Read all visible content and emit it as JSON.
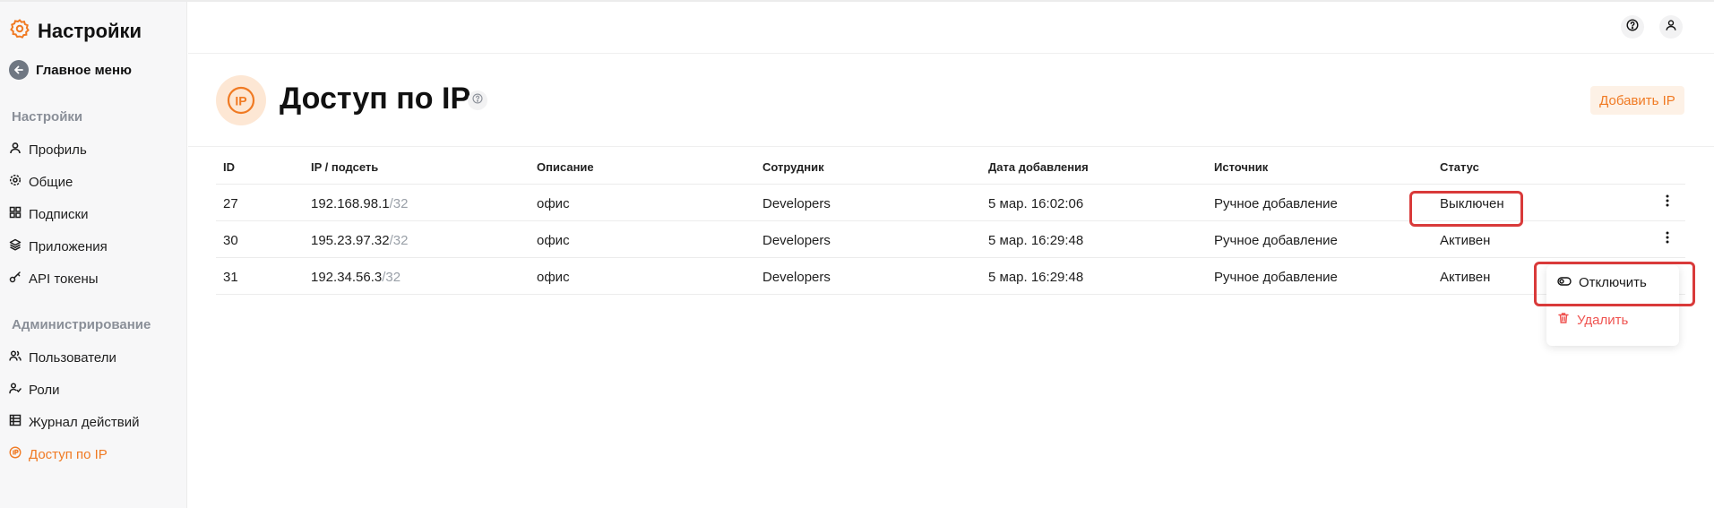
{
  "sidebar": {
    "title": "Настройки",
    "back_label": "Главное меню",
    "section_settings": "Настройки",
    "settings_items": [
      {
        "label": "Профиль",
        "icon": "user-icon"
      },
      {
        "label": "Общие",
        "icon": "gear-icon"
      },
      {
        "label": "Подписки",
        "icon": "grid-icon"
      },
      {
        "label": "Приложения",
        "icon": "layers-icon"
      },
      {
        "label": "API токены",
        "icon": "key-icon"
      }
    ],
    "section_admin": "Администрирование",
    "admin_items": [
      {
        "label": "Пользователи",
        "icon": "users-icon"
      },
      {
        "label": "Роли",
        "icon": "user-check-icon"
      },
      {
        "label": "Журнал действий",
        "icon": "journal-icon"
      },
      {
        "label": "Доступ по IP",
        "icon": "ip-icon",
        "active": true
      }
    ]
  },
  "header": {
    "help_icon": "help-icon",
    "profile_icon": "profile-icon"
  },
  "page": {
    "title": "Доступ по IP",
    "icon_text": "IP",
    "add_button": "Добавить IP"
  },
  "table": {
    "columns": [
      "ID",
      "IP / подсеть",
      "Описание",
      "Сотрудник",
      "Дата добавления",
      "Источник",
      "Статус"
    ],
    "rows": [
      {
        "id": "27",
        "ip": "192.168.98.1",
        "mask": "/32",
        "description": "офис",
        "employee": "Developers",
        "date": "5 мар. 16:02:06",
        "source": "Ручное добавление",
        "status": "Выключен"
      },
      {
        "id": "30",
        "ip": "195.23.97.32",
        "mask": "/32",
        "description": "офис",
        "employee": "Developers",
        "date": "5 мар. 16:29:48",
        "source": "Ручное добавление",
        "status": "Активен"
      },
      {
        "id": "31",
        "ip": "192.34.56.3",
        "mask": "/32",
        "description": "офис",
        "employee": "Developers",
        "date": "5 мар. 16:29:48",
        "source": "Ручное добавление",
        "status": "Активен"
      }
    ]
  },
  "menu": {
    "disable_label": "Отключить",
    "delete_label": "Удалить"
  },
  "colors": {
    "accent": "#f07a23",
    "highlight": "#d93a3a",
    "danger": "#ef5350"
  }
}
